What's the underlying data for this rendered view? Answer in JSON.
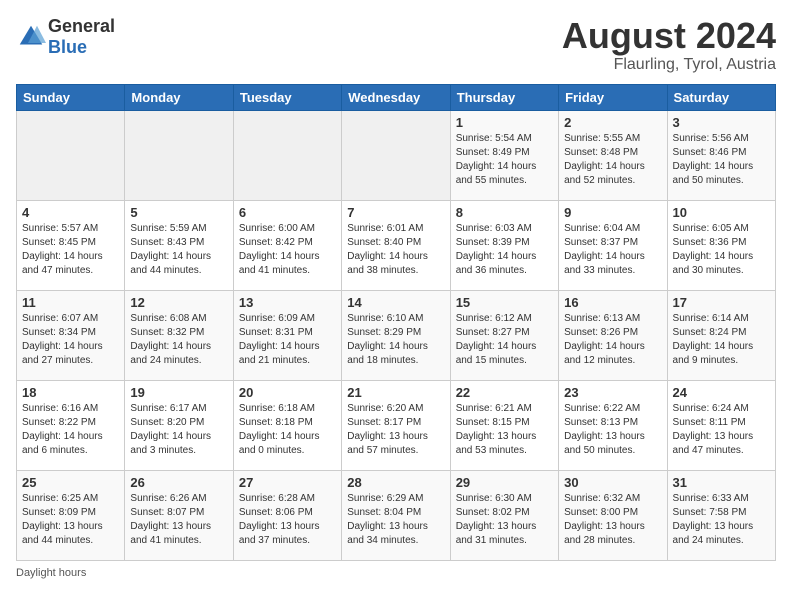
{
  "header": {
    "logo_general": "General",
    "logo_blue": "Blue",
    "title": "August 2024",
    "subtitle": "Flaurling, Tyrol, Austria"
  },
  "days_of_week": [
    "Sunday",
    "Monday",
    "Tuesday",
    "Wednesday",
    "Thursday",
    "Friday",
    "Saturday"
  ],
  "weeks": [
    [
      {
        "day": "",
        "info": ""
      },
      {
        "day": "",
        "info": ""
      },
      {
        "day": "",
        "info": ""
      },
      {
        "day": "",
        "info": ""
      },
      {
        "day": "1",
        "info": "Sunrise: 5:54 AM\nSunset: 8:49 PM\nDaylight: 14 hours\nand 55 minutes."
      },
      {
        "day": "2",
        "info": "Sunrise: 5:55 AM\nSunset: 8:48 PM\nDaylight: 14 hours\nand 52 minutes."
      },
      {
        "day": "3",
        "info": "Sunrise: 5:56 AM\nSunset: 8:46 PM\nDaylight: 14 hours\nand 50 minutes."
      }
    ],
    [
      {
        "day": "4",
        "info": "Sunrise: 5:57 AM\nSunset: 8:45 PM\nDaylight: 14 hours\nand 47 minutes."
      },
      {
        "day": "5",
        "info": "Sunrise: 5:59 AM\nSunset: 8:43 PM\nDaylight: 14 hours\nand 44 minutes."
      },
      {
        "day": "6",
        "info": "Sunrise: 6:00 AM\nSunset: 8:42 PM\nDaylight: 14 hours\nand 41 minutes."
      },
      {
        "day": "7",
        "info": "Sunrise: 6:01 AM\nSunset: 8:40 PM\nDaylight: 14 hours\nand 38 minutes."
      },
      {
        "day": "8",
        "info": "Sunrise: 6:03 AM\nSunset: 8:39 PM\nDaylight: 14 hours\nand 36 minutes."
      },
      {
        "day": "9",
        "info": "Sunrise: 6:04 AM\nSunset: 8:37 PM\nDaylight: 14 hours\nand 33 minutes."
      },
      {
        "day": "10",
        "info": "Sunrise: 6:05 AM\nSunset: 8:36 PM\nDaylight: 14 hours\nand 30 minutes."
      }
    ],
    [
      {
        "day": "11",
        "info": "Sunrise: 6:07 AM\nSunset: 8:34 PM\nDaylight: 14 hours\nand 27 minutes."
      },
      {
        "day": "12",
        "info": "Sunrise: 6:08 AM\nSunset: 8:32 PM\nDaylight: 14 hours\nand 24 minutes."
      },
      {
        "day": "13",
        "info": "Sunrise: 6:09 AM\nSunset: 8:31 PM\nDaylight: 14 hours\nand 21 minutes."
      },
      {
        "day": "14",
        "info": "Sunrise: 6:10 AM\nSunset: 8:29 PM\nDaylight: 14 hours\nand 18 minutes."
      },
      {
        "day": "15",
        "info": "Sunrise: 6:12 AM\nSunset: 8:27 PM\nDaylight: 14 hours\nand 15 minutes."
      },
      {
        "day": "16",
        "info": "Sunrise: 6:13 AM\nSunset: 8:26 PM\nDaylight: 14 hours\nand 12 minutes."
      },
      {
        "day": "17",
        "info": "Sunrise: 6:14 AM\nSunset: 8:24 PM\nDaylight: 14 hours\nand 9 minutes."
      }
    ],
    [
      {
        "day": "18",
        "info": "Sunrise: 6:16 AM\nSunset: 8:22 PM\nDaylight: 14 hours\nand 6 minutes."
      },
      {
        "day": "19",
        "info": "Sunrise: 6:17 AM\nSunset: 8:20 PM\nDaylight: 14 hours\nand 3 minutes."
      },
      {
        "day": "20",
        "info": "Sunrise: 6:18 AM\nSunset: 8:18 PM\nDaylight: 14 hours and 0 minutes."
      },
      {
        "day": "21",
        "info": "Sunrise: 6:20 AM\nSunset: 8:17 PM\nDaylight: 13 hours\nand 57 minutes."
      },
      {
        "day": "22",
        "info": "Sunrise: 6:21 AM\nSunset: 8:15 PM\nDaylight: 13 hours\nand 53 minutes."
      },
      {
        "day": "23",
        "info": "Sunrise: 6:22 AM\nSunset: 8:13 PM\nDaylight: 13 hours\nand 50 minutes."
      },
      {
        "day": "24",
        "info": "Sunrise: 6:24 AM\nSunset: 8:11 PM\nDaylight: 13 hours\nand 47 minutes."
      }
    ],
    [
      {
        "day": "25",
        "info": "Sunrise: 6:25 AM\nSunset: 8:09 PM\nDaylight: 13 hours\nand 44 minutes."
      },
      {
        "day": "26",
        "info": "Sunrise: 6:26 AM\nSunset: 8:07 PM\nDaylight: 13 hours\nand 41 minutes."
      },
      {
        "day": "27",
        "info": "Sunrise: 6:28 AM\nSunset: 8:06 PM\nDaylight: 13 hours\nand 37 minutes."
      },
      {
        "day": "28",
        "info": "Sunrise: 6:29 AM\nSunset: 8:04 PM\nDaylight: 13 hours\nand 34 minutes."
      },
      {
        "day": "29",
        "info": "Sunrise: 6:30 AM\nSunset: 8:02 PM\nDaylight: 13 hours\nand 31 minutes."
      },
      {
        "day": "30",
        "info": "Sunrise: 6:32 AM\nSunset: 8:00 PM\nDaylight: 13 hours\nand 28 minutes."
      },
      {
        "day": "31",
        "info": "Sunrise: 6:33 AM\nSunset: 7:58 PM\nDaylight: 13 hours\nand 24 minutes."
      }
    ]
  ],
  "footer": "Daylight hours"
}
